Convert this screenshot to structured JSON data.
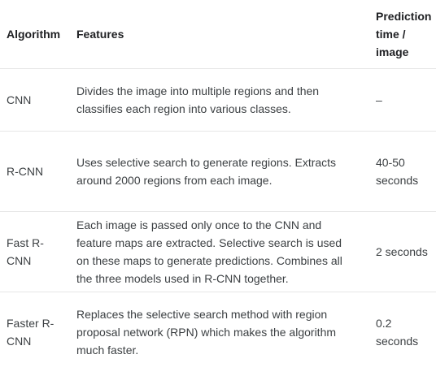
{
  "table": {
    "headers": {
      "algorithm": "Algorithm",
      "features": "Features",
      "prediction_time": "Prediction time / image"
    },
    "rows": [
      {
        "algorithm": "CNN",
        "features": "Divides the image into multiple regions and then classifies each region into various classes.",
        "prediction_time": "–"
      },
      {
        "algorithm": "R-CNN",
        "features": "Uses selective search to generate regions. Extracts around 2000 regions from each image.",
        "prediction_time": "40-50 seconds"
      },
      {
        "algorithm": "Fast R-CNN",
        "features": "Each image is passed only once to the CNN and feature maps are extracted. Selective search is used on these maps to generate predictions. Combines all the three models used in R-CNN together.",
        "prediction_time": "2 seconds"
      },
      {
        "algorithm": "Faster R-CNN",
        "features": "Replaces the selective search method with region proposal network (RPN) which makes the algorithm much faster.",
        "prediction_time": "0.2 seconds"
      }
    ]
  }
}
